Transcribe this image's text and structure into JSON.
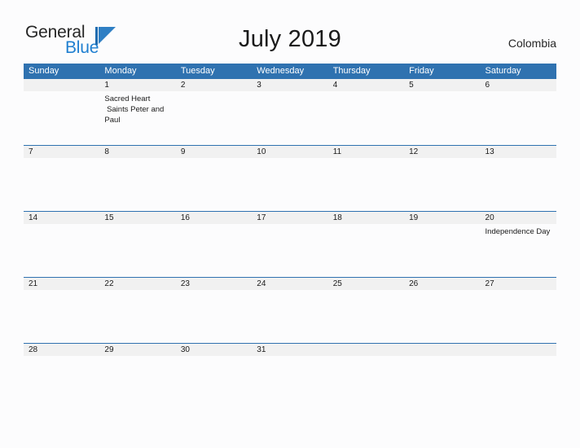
{
  "brand": {
    "name_top": "General",
    "name_bottom": "Blue",
    "triangle_icon": "blue-triangle-icon",
    "accent_color": "#1f7fd0"
  },
  "header": {
    "title": "July 2019",
    "region": "Colombia"
  },
  "colors": {
    "header_blue": "#2f72b0",
    "date_bar_gray": "#f1f1f1",
    "page_background": "#fcfcfd",
    "text": "#1a1a1a"
  },
  "calendar": {
    "weekdays": [
      "Sunday",
      "Monday",
      "Tuesday",
      "Wednesday",
      "Thursday",
      "Friday",
      "Saturday"
    ],
    "weeks": [
      {
        "days": [
          {
            "number": "",
            "events": ""
          },
          {
            "number": "1",
            "events": "Sacred Heart\n Saints Peter and Paul"
          },
          {
            "number": "2",
            "events": ""
          },
          {
            "number": "3",
            "events": ""
          },
          {
            "number": "4",
            "events": ""
          },
          {
            "number": "5",
            "events": ""
          },
          {
            "number": "6",
            "events": ""
          }
        ]
      },
      {
        "days": [
          {
            "number": "7",
            "events": ""
          },
          {
            "number": "8",
            "events": ""
          },
          {
            "number": "9",
            "events": ""
          },
          {
            "number": "10",
            "events": ""
          },
          {
            "number": "11",
            "events": ""
          },
          {
            "number": "12",
            "events": ""
          },
          {
            "number": "13",
            "events": ""
          }
        ]
      },
      {
        "days": [
          {
            "number": "14",
            "events": ""
          },
          {
            "number": "15",
            "events": ""
          },
          {
            "number": "16",
            "events": ""
          },
          {
            "number": "17",
            "events": ""
          },
          {
            "number": "18",
            "events": ""
          },
          {
            "number": "19",
            "events": ""
          },
          {
            "number": "20",
            "events": "Independence Day"
          }
        ]
      },
      {
        "days": [
          {
            "number": "21",
            "events": ""
          },
          {
            "number": "22",
            "events": ""
          },
          {
            "number": "23",
            "events": ""
          },
          {
            "number": "24",
            "events": ""
          },
          {
            "number": "25",
            "events": ""
          },
          {
            "number": "26",
            "events": ""
          },
          {
            "number": "27",
            "events": ""
          }
        ]
      },
      {
        "days": [
          {
            "number": "28",
            "events": ""
          },
          {
            "number": "29",
            "events": ""
          },
          {
            "number": "30",
            "events": ""
          },
          {
            "number": "31",
            "events": ""
          },
          {
            "number": "",
            "events": ""
          },
          {
            "number": "",
            "events": ""
          },
          {
            "number": "",
            "events": ""
          }
        ]
      }
    ]
  }
}
